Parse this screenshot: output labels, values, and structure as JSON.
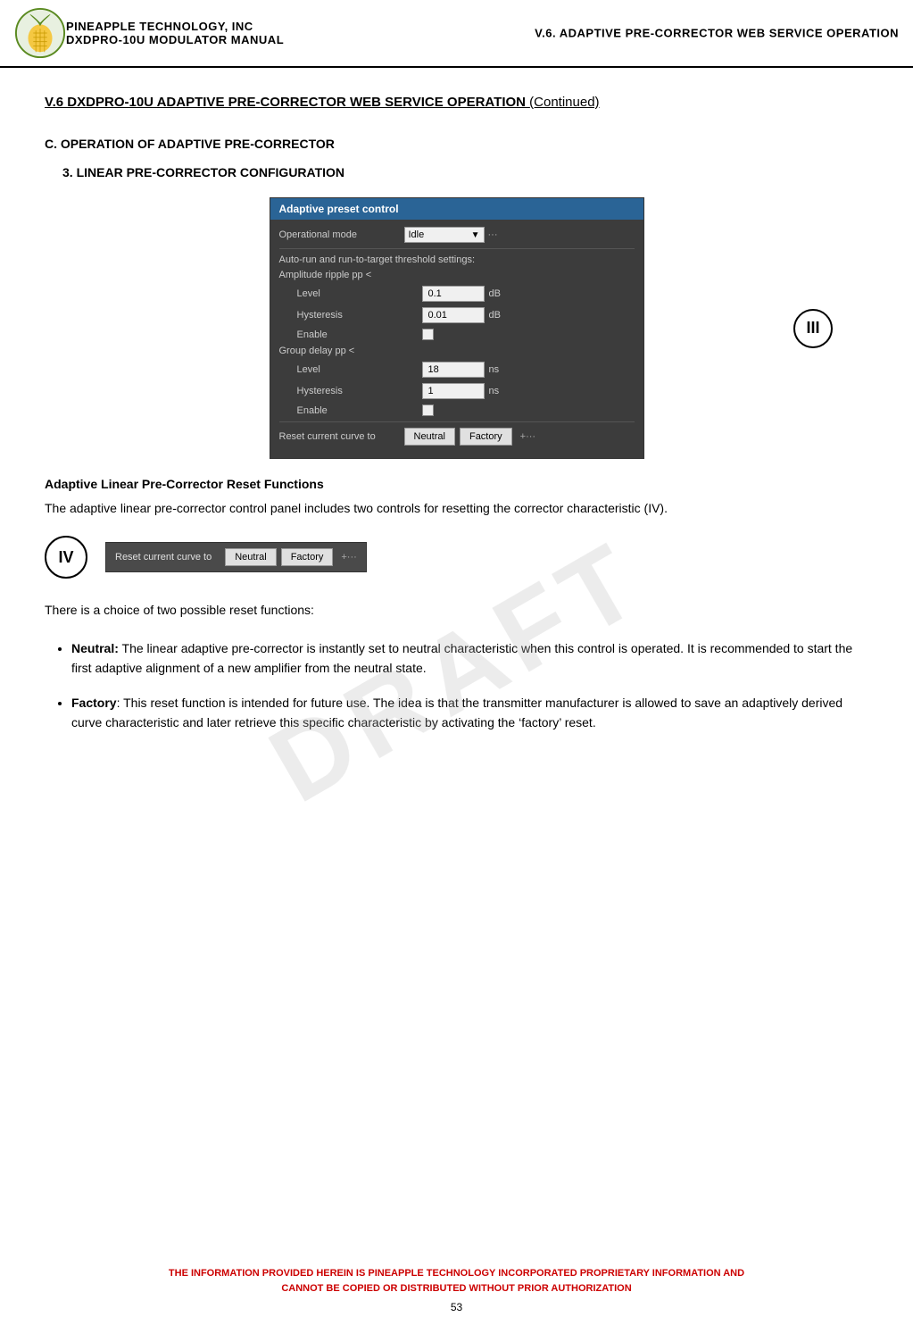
{
  "header": {
    "company": "PINEAPPLE TECHNOLOGY, INC",
    "model": "DXDPRO-10U MODULATOR MANUAL",
    "section": "V.6. ADAPTIVE PRE-CORRECTOR WEB SERVICE OPERATION"
  },
  "page_title": {
    "main": "V.6  DXDPRO-10U ADAPTIVE PRE-CORRECTOR WEB SERVICE OPERATION",
    "continued": "(Continued)"
  },
  "section_c": {
    "heading": "C.   OPERATION OF ADAPTIVE PRE-CORRECTOR",
    "sub_heading": "3.  LINEAR PRE-CORRECTOR CONFIGURATION"
  },
  "control_panel": {
    "title": "Adaptive preset control",
    "op_mode_label": "Operational mode",
    "op_mode_value": "Idle",
    "auto_run_label": "Auto-run and run-to-target threshold settings:",
    "amplitude_label": "Amplitude ripple pp <",
    "amplitude_level_label": "Level",
    "amplitude_level_value": "0.1",
    "amplitude_level_unit": "dB",
    "amplitude_hysteresis_label": "Hysteresis",
    "amplitude_hysteresis_value": "0.01",
    "amplitude_hysteresis_unit": "dB",
    "amplitude_enable_label": "Enable",
    "group_delay_label": "Group delay pp <",
    "group_delay_level_label": "Level",
    "group_delay_level_value": "18",
    "group_delay_level_unit": "ns",
    "group_delay_hysteresis_label": "Hysteresis",
    "group_delay_hysteresis_value": "1",
    "group_delay_hysteresis_unit": "ns",
    "group_delay_enable_label": "Enable",
    "reset_label": "Reset current curve to",
    "neutral_button": "Neutral",
    "factory_button": "Factory",
    "circle_label": "III"
  },
  "adaptive_reset": {
    "heading": "Adaptive Linear Pre-Corrector Reset Functions",
    "body": "The adaptive linear pre-corrector control panel includes two controls for resetting the corrector characteristic (IV).",
    "iv_reset_label": "Reset current curve to",
    "iv_neutral_button": "Neutral",
    "iv_factory_button": "Factory",
    "circle_label": "IV"
  },
  "choice_text": "There is a choice of two possible reset functions:",
  "bullets": [
    {
      "term": "Neutral:",
      "text": " The linear adaptive pre-corrector is instantly set to neutral characteristic when this control is operated. It is recommended to start the first adaptive alignment of a new amplifier from the neutral state."
    },
    {
      "term": "Factory",
      "text": ": This reset function is intended for future use. The idea is that the transmitter manufacturer is allowed to save an adaptively derived curve characteristic and later retrieve this specific characteristic by activating the ‘factory’ reset."
    }
  ],
  "watermark": "DRAFT",
  "footer": {
    "line1": "THE INFORMATION PROVIDED HEREIN IS PINEAPPLE TECHNOLOGY INCORPORATED PROPRIETARY INFORMATION AND",
    "line2": "CANNOT BE COPIED OR DISTRIBUTED WITHOUT PRIOR AUTHORIZATION",
    "page_number": "53"
  }
}
